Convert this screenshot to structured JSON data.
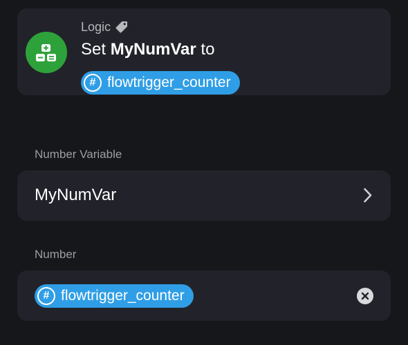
{
  "header": {
    "category": "Logic",
    "category_icon": "tag-icon",
    "action_icon": "calculator-icon",
    "title_prefix": "Set",
    "title_variable": "MyNumVar",
    "title_suffix": "to",
    "token_label": "flowtrigger_counter",
    "token_symbol": "#",
    "accent_green": "#2ea23a",
    "token_color": "#2f9ee6"
  },
  "number_variable": {
    "label": "Number Variable",
    "value": "MyNumVar",
    "chevron_icon": "chevron-right-icon"
  },
  "number": {
    "label": "Number",
    "token_label": "flowtrigger_counter",
    "token_symbol": "#",
    "clear_icon": "close-icon"
  }
}
